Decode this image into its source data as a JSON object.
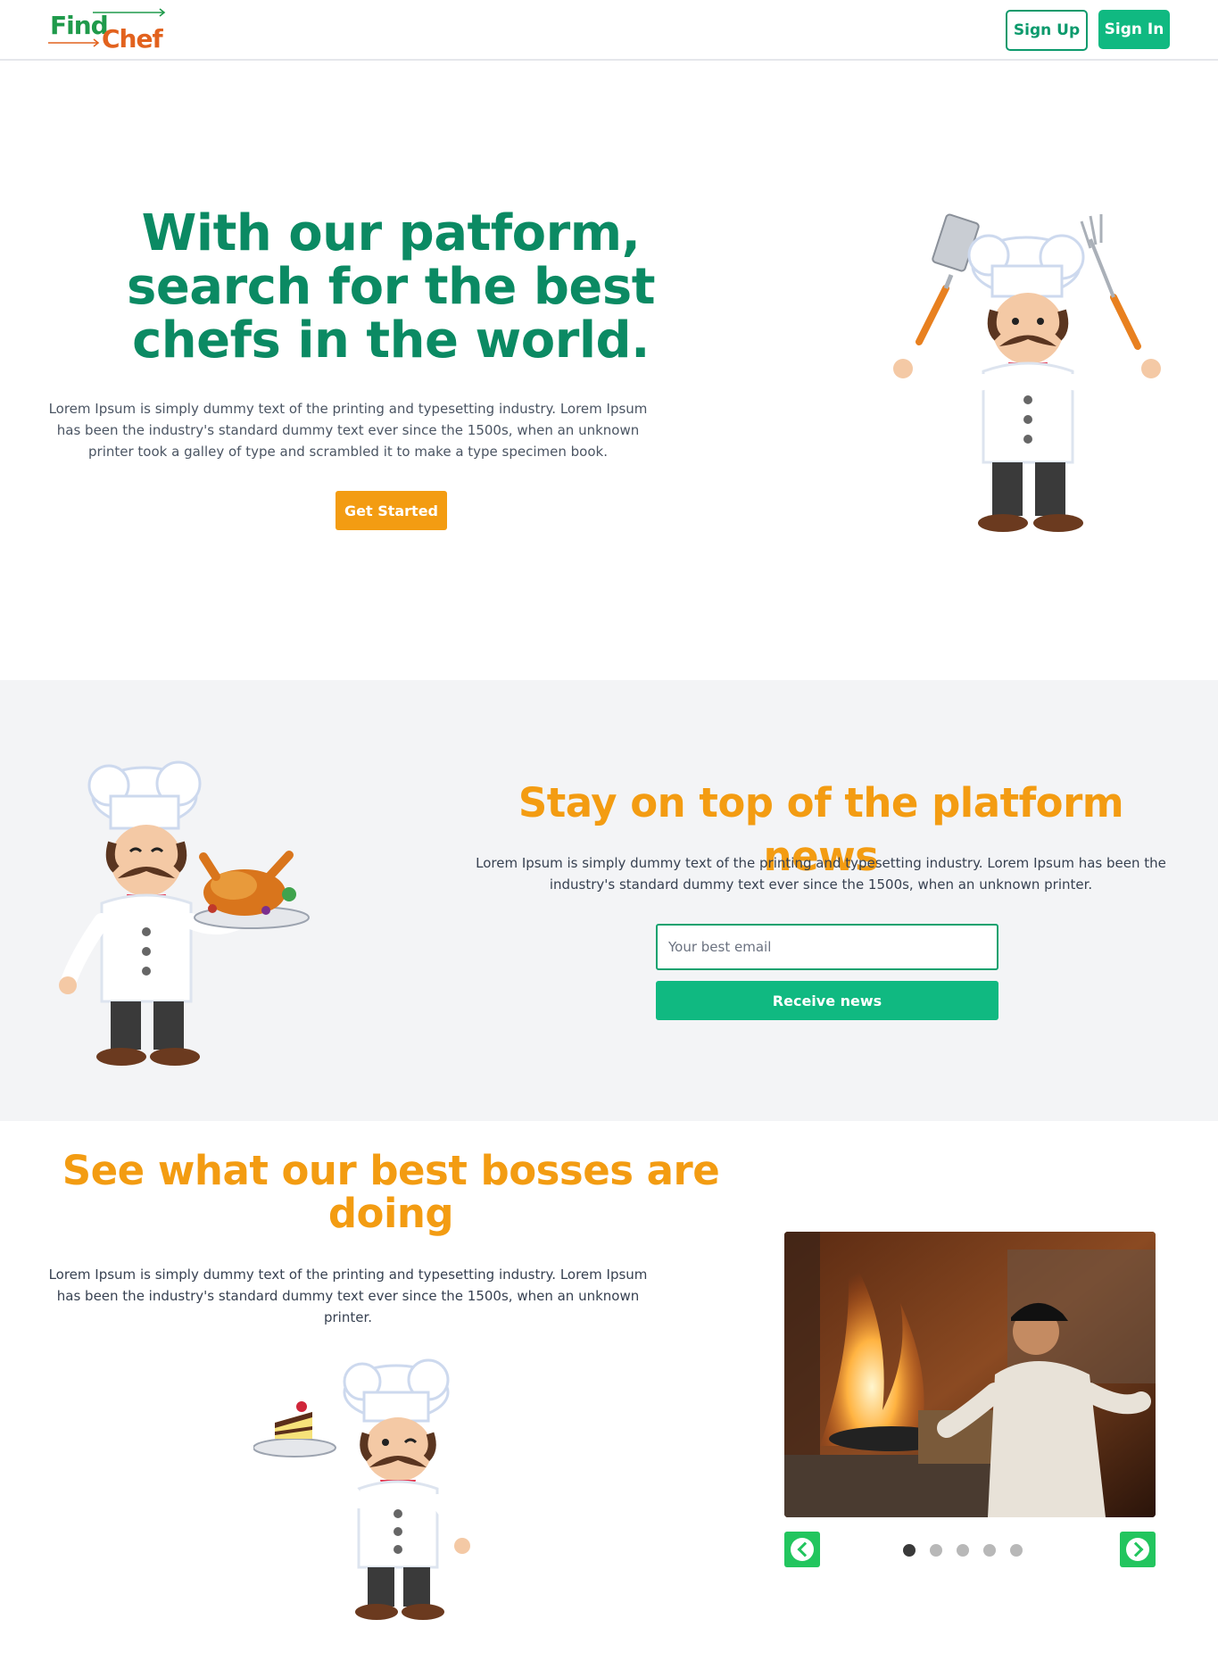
{
  "nav": {
    "logo_find": "Find",
    "logo_chef": "Chef",
    "signup_label": "Sign Up",
    "signin_label": "Sign In"
  },
  "hero": {
    "title": "With our patform, search for the best chefs in the world.",
    "text": "Lorem Ipsum is simply dummy text of the printing and typesetting industry. Lorem Ipsum has been the industry's standard dummy text ever since the 1500s, when an unknown printer took a galley of type and scrambled it to make a type specimen book.",
    "cta_label": "Get Started"
  },
  "news": {
    "title": "Stay on top of the platform news",
    "text": "Lorem Ipsum is simply dummy text of the printing and typesetting industry. Lorem Ipsum has been the industry's standard dummy text ever since the 1500s, when an unknown printer.",
    "email_placeholder": "Your best email",
    "button_label": "Receive news"
  },
  "bosses": {
    "title": "See what our best bosses are doing",
    "text": "Lorem Ipsum is simply dummy text of the printing and typesetting industry. Lorem Ipsum has been the industry's standard dummy text ever since the 1500s, when an unknown printer.",
    "carousel": {
      "slide_count": 5,
      "active_index": 0,
      "prev_icon": "chevron-left-icon",
      "next_icon": "chevron-right-icon"
    }
  },
  "colors": {
    "brand_green": "#10b981",
    "dark_green": "#0b8a63",
    "accent_orange": "#f39c12",
    "logo_orange": "#e2621e"
  }
}
